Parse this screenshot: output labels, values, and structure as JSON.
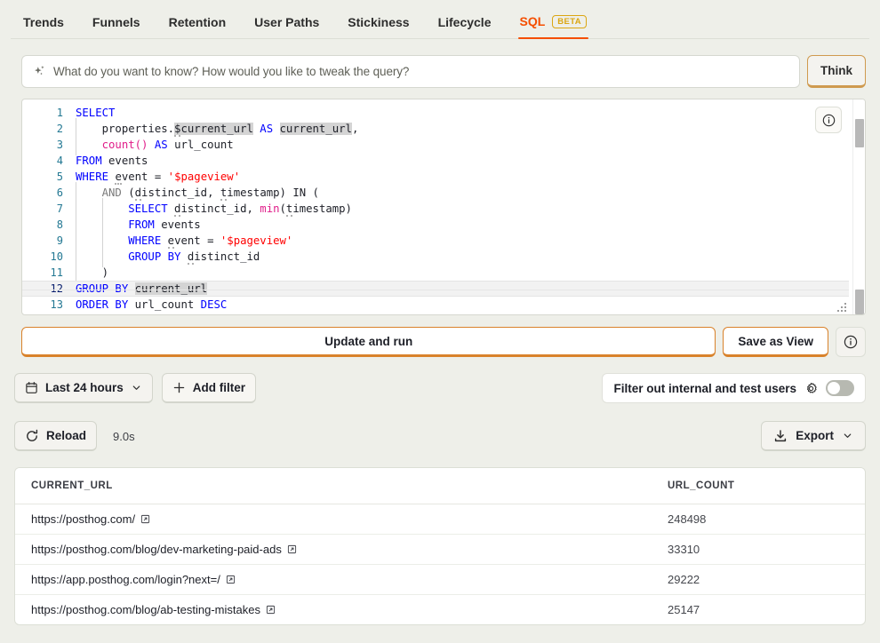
{
  "tabs": [
    {
      "label": "Trends",
      "active": false
    },
    {
      "label": "Funnels",
      "active": false
    },
    {
      "label": "Retention",
      "active": false
    },
    {
      "label": "User Paths",
      "active": false
    },
    {
      "label": "Stickiness",
      "active": false
    },
    {
      "label": "Lifecycle",
      "active": false
    },
    {
      "label": "SQL",
      "active": true,
      "badge": "BETA"
    }
  ],
  "ai": {
    "icon": "sparkles-icon",
    "placeholder": "What do you want to know? How would you like to tweak the query?",
    "value": "",
    "think_label": "Think"
  },
  "editor": {
    "info_icon": "info-circle-icon",
    "current_line": 12,
    "lines": [
      {
        "n": "1",
        "text": "SELECT"
      },
      {
        "n": "2",
        "text": "    properties.$current_url AS current_url,"
      },
      {
        "n": "3",
        "text": "    count() AS url_count"
      },
      {
        "n": "4",
        "text": "FROM events"
      },
      {
        "n": "5",
        "text": "WHERE event = '$pageview'"
      },
      {
        "n": "6",
        "text": "    AND (distinct_id, timestamp) IN ("
      },
      {
        "n": "7",
        "text": "        SELECT distinct_id, min(timestamp)"
      },
      {
        "n": "8",
        "text": "        FROM events"
      },
      {
        "n": "9",
        "text": "        WHERE event = '$pageview'"
      },
      {
        "n": "10",
        "text": "        GROUP BY distinct_id"
      },
      {
        "n": "11",
        "text": "    )"
      },
      {
        "n": "12",
        "text": "GROUP BY current_url"
      },
      {
        "n": "13",
        "text": "ORDER BY url_count DESC"
      }
    ]
  },
  "actions": {
    "update_and_run": "Update and run",
    "save_as_view": "Save as View",
    "info_icon": "info-circle-icon"
  },
  "filters": {
    "date_range": "Last 24 hours",
    "date_icon": "calendar-icon",
    "chevron_icon": "chevron-down-icon",
    "add_filter": "Add filter",
    "plus_icon": "plus-icon",
    "internal_label": "Filter out internal and test users",
    "gear_icon": "gear-icon",
    "internal_enabled": false
  },
  "results_toolbar": {
    "reload_label": "Reload",
    "reload_icon": "refresh-icon",
    "elapsed": "9.0s",
    "export_label": "Export",
    "export_icon": "download-icon",
    "export_chevron_icon": "chevron-down-icon"
  },
  "results_table": {
    "columns": [
      "CURRENT_URL",
      "URL_COUNT"
    ],
    "external_link_icon": "external-link-icon",
    "rows": [
      {
        "current_url": "https://posthog.com/",
        "url_count": "248498"
      },
      {
        "current_url": "https://posthog.com/blog/dev-marketing-paid-ads",
        "url_count": "33310"
      },
      {
        "current_url": "https://app.posthog.com/login?next=/",
        "url_count": "29222"
      },
      {
        "current_url": "https://posthog.com/blog/ab-testing-mistakes",
        "url_count": "25147"
      }
    ]
  },
  "colors": {
    "accent": "#f54e00",
    "beta": "#dba612",
    "page_bg": "#eeefe9",
    "panel_bg": "#ffffff",
    "button_border": "#d9822b"
  }
}
